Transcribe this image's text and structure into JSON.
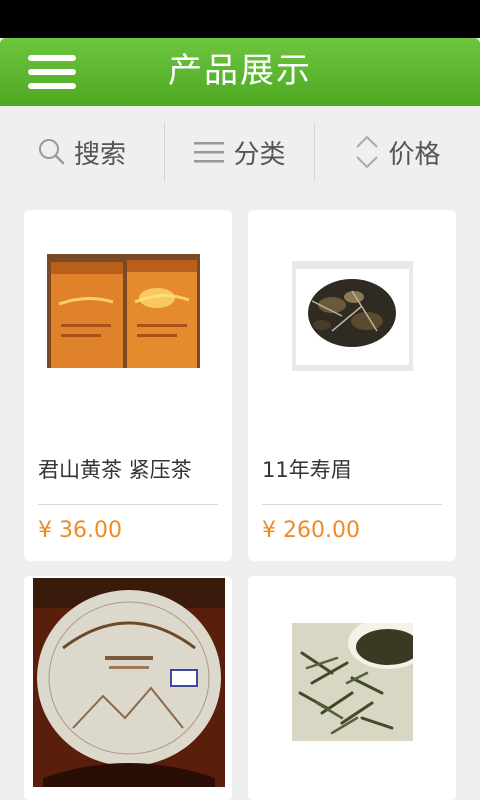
{
  "header": {
    "title": "产品展示",
    "menu_icon": "menu-icon"
  },
  "filters": [
    {
      "label": "搜索",
      "icon": "search-icon"
    },
    {
      "label": "分类",
      "icon": "list-icon"
    },
    {
      "label": "价格",
      "icon": "sort-icon"
    }
  ],
  "products": [
    {
      "name": "君山黄茶 紧压茶",
      "price": "¥ 36.00",
      "image": "yellow-tea-packages-image"
    },
    {
      "name": "11年寿眉",
      "price": "¥ 260.00",
      "image": "shoumei-leaves-image"
    },
    {
      "name": "",
      "price": "",
      "image": "white-tea-cake-image"
    },
    {
      "name": "",
      "price": "",
      "image": "green-tea-leaves-image"
    }
  ],
  "colors": {
    "header_green": "#5cb82f",
    "price_orange": "#f08a28",
    "background": "#efefef"
  }
}
